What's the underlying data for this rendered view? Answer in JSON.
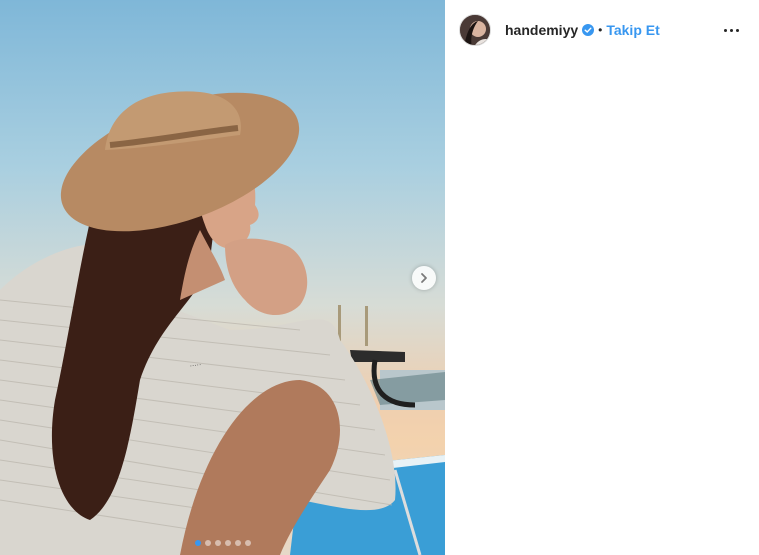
{
  "header": {
    "username": "handemiyy",
    "separator": "•",
    "follow_label": "Takip Et",
    "verified_icon": "verified-badge-icon",
    "more_icon": "more-options-icon",
    "accent_color": "#3897f0"
  },
  "media": {
    "next_icon": "chevron-right-icon",
    "carousel": {
      "total": 6,
      "active_index": 0
    }
  }
}
